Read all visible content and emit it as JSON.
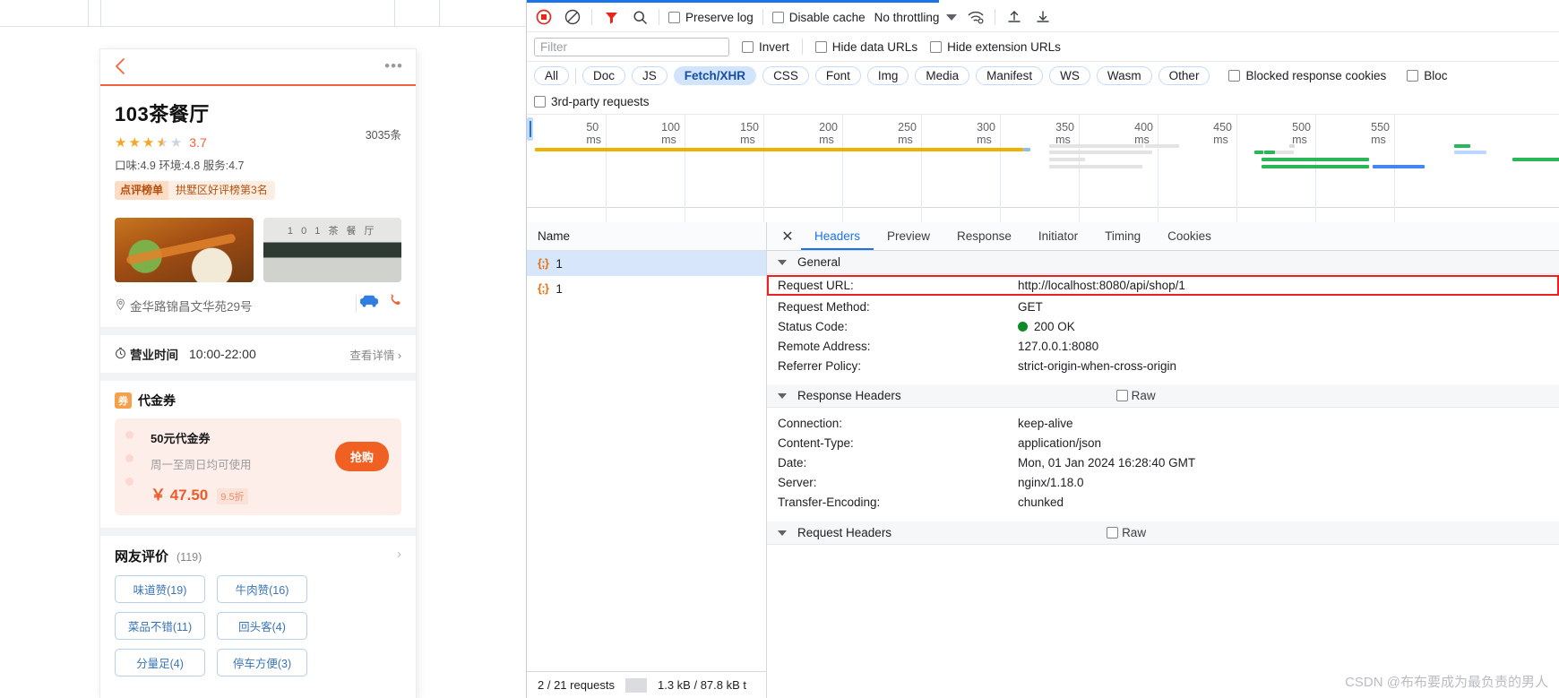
{
  "shop": {
    "name": "103茶餐厅",
    "rating": "3.7",
    "review_count": "3035条",
    "sub_scores": "口味:4.9 环境:4.8 服务:4.7",
    "badge_label": "点评榜单",
    "badge_text": "拱墅区好评榜第3名",
    "address": "金华路锦昌文华苑29号",
    "hours_label": "营业时间",
    "hours_value": "10:00-22:00",
    "hours_more": "查看详情",
    "photo_shop_sign": "1 0 1 茶 餐 厅"
  },
  "coupon": {
    "tag": "券",
    "title": "代金券",
    "name": "50元代金券",
    "usage": "周一至周日均可使用",
    "price": "￥ 47.50",
    "discount": "9.5折",
    "buy_label": "抢购"
  },
  "reviews": {
    "title": "网友评价",
    "count": "(119)",
    "tags": [
      "味道赞(19)",
      "牛肉赞(16)",
      "菜品不错(11)",
      "回头客(4)",
      "分量足(4)",
      "停车方便(3)"
    ]
  },
  "devtools": {
    "toolbar": {
      "record_icon": "record-stop-icon",
      "clear_icon": "clear-icon",
      "filter_icon": "filter-icon",
      "search_icon": "search-icon",
      "preserve_log": "Preserve log",
      "disable_cache": "Disable cache",
      "throttling": "No throttling",
      "wifi_icon": "network-conditions-icon",
      "import_icon": "import-har-icon",
      "export_icon": "export-har-icon"
    },
    "filter": {
      "placeholder": "Filter",
      "value": "",
      "invert": "Invert",
      "hide_data_urls": "Hide data URLs",
      "hide_extension_urls": "Hide extension URLs"
    },
    "types": [
      "All",
      "Doc",
      "JS",
      "Fetch/XHR",
      "CSS",
      "Font",
      "Img",
      "Media",
      "Manifest",
      "WS",
      "Wasm",
      "Other"
    ],
    "active_type": "Fetch/XHR",
    "blocked_cookies": "Blocked response cookies",
    "blocked_requests": "Bloc",
    "third_party": "3rd-party requests",
    "timeline_ticks": [
      "50 ms",
      "100 ms",
      "150 ms",
      "200 ms",
      "250 ms",
      "300 ms",
      "350 ms",
      "400 ms",
      "450 ms",
      "500 ms",
      "550 ms"
    ],
    "name_column_header": "Name",
    "requests": [
      {
        "name": "1",
        "icon": "json-icon",
        "selected": true
      },
      {
        "name": "1",
        "icon": "json-icon",
        "selected": false
      }
    ],
    "status_bar": {
      "requests": "2 / 21 requests",
      "transferred": "1.3 kB / 87.8 kB t"
    },
    "tabs": [
      "Headers",
      "Preview",
      "Response",
      "Initiator",
      "Timing",
      "Cookies"
    ],
    "active_tab": "Headers",
    "general": {
      "section": "General",
      "rows": [
        {
          "key": "Request URL:",
          "value": "http://localhost:8080/api/shop/1",
          "highlight": true
        },
        {
          "key": "Request Method:",
          "value": "GET",
          "highlight": false
        },
        {
          "key": "Status Code:",
          "value": "200 OK",
          "highlight": false,
          "status_dot": true
        },
        {
          "key": "Remote Address:",
          "value": "127.0.0.1:8080",
          "highlight": false
        },
        {
          "key": "Referrer Policy:",
          "value": "strict-origin-when-cross-origin",
          "highlight": false
        }
      ]
    },
    "response_headers": {
      "section": "Response Headers",
      "raw": "Raw",
      "rows": [
        {
          "key": "Connection:",
          "value": "keep-alive"
        },
        {
          "key": "Content-Type:",
          "value": "application/json"
        },
        {
          "key": "Date:",
          "value": "Mon, 01 Jan 2024 16:28:40 GMT"
        },
        {
          "key": "Server:",
          "value": "nginx/1.18.0"
        },
        {
          "key": "Transfer-Encoding:",
          "value": "chunked"
        }
      ]
    },
    "request_headers": {
      "section": "Request Headers",
      "raw": "Raw"
    }
  },
  "watermark": "CSDN @布布要成为最负责的男人",
  "colors": {
    "accent_blue": "#1a73e8",
    "brand_orange": "#f0613c",
    "status_green": "#0c8c26",
    "highlight_red": "#f02020"
  }
}
